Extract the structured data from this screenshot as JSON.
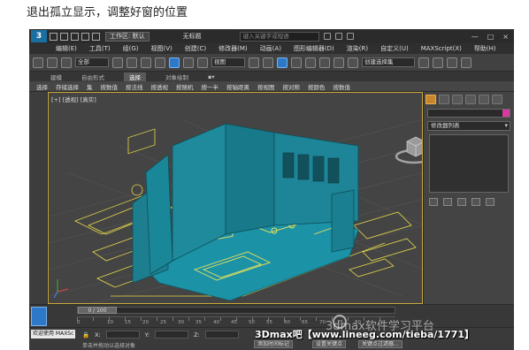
{
  "caption": "退出孤立显示，调整好窗的位置",
  "titlebar": {
    "logo": "3",
    "workspace": "工作区: 默认",
    "doc_title": "无标题",
    "search_placeholder": "键入关键字或短语",
    "window_controls": [
      "—",
      "□",
      "×"
    ]
  },
  "menubar": {
    "items": [
      "编辑(E)",
      "工具(T)",
      "组(G)",
      "视图(V)",
      "创建(C)",
      "修改器(M)",
      "动画(A)",
      "图形编辑器(D)",
      "渲染(R)",
      "自定义(U)",
      "MAXScript(X)",
      "帮助(H)"
    ]
  },
  "toolbar": {
    "selection_filter": "全部",
    "reference_coord": "视图",
    "named_selection": "创建选择集"
  },
  "ribbon": {
    "tabs": [
      "建模",
      "自由形式",
      "选择",
      "对象绘制",
      "▪▾"
    ],
    "active_tab": "选择",
    "sub_items": [
      "选择",
      "存储选择",
      "集",
      "按数值",
      "按法线",
      "按透视",
      "按随机",
      "按一半",
      "按轴距离",
      "按视图",
      "按对称",
      "按颜色",
      "按数值"
    ]
  },
  "viewport": {
    "label": "[+] [透视] [真实]"
  },
  "command_panel": {
    "modifier_list": "修改器列表"
  },
  "timeline": {
    "frame_display": "0 / 100",
    "ruler_marks": [
      "0",
      "10",
      "15",
      "20",
      "25",
      "30",
      "35",
      "40",
      "45",
      "50",
      "55",
      "60",
      "65",
      "70",
      "75",
      "80"
    ]
  },
  "statusbar": {
    "maxscript_label": "欢迎使用 MAXSc",
    "hint": "单击并拖动以选择对象",
    "add_time_tag": "添加时间标记",
    "key_filter": "设置关键点",
    "key_filter2": "关键点过滤器..."
  },
  "watermark": {
    "brand": "3Dmax吧【www.lineeg.com/tieba/1771】",
    "faint": "3dmax软件学习平台"
  },
  "colors": {
    "walls": "#1f8a9c",
    "floor": "#1b92a6",
    "plan_lines": "#e4d84a",
    "viewport_bg": "#444444",
    "active_border": "#c9a83a"
  }
}
